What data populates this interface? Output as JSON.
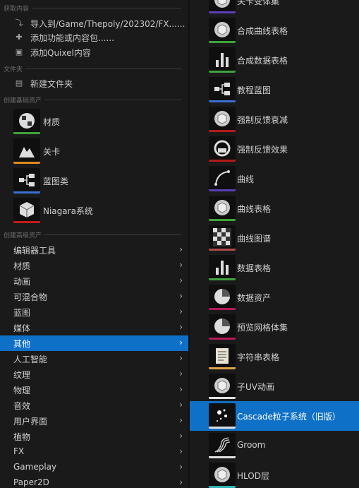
{
  "left": {
    "sections": {
      "get_content": "获取内容",
      "folder": "文件夹",
      "basic_assets": "创建基础资产",
      "advanced_assets": "创建高级资产"
    },
    "get_content_items": [
      {
        "label": "导入到/Game/Thepoly/202302/FX......",
        "icon": "import-icon"
      },
      {
        "label": "添加功能或内容包......",
        "icon": "add-feature-icon"
      },
      {
        "label": "添加Quixel内容",
        "icon": "quixel-icon"
      }
    ],
    "folder_items": [
      {
        "label": "新建文件夹",
        "icon": "new-folder-icon"
      }
    ],
    "basic_assets": [
      {
        "label": "材质",
        "icon": "material-icon",
        "color": "#3fa33a"
      },
      {
        "label": "关卡",
        "icon": "level-icon",
        "color": "#e08a1e"
      },
      {
        "label": "蓝图类",
        "icon": "blueprint-icon",
        "color": "#3c6fd6"
      },
      {
        "label": "Niagara系统",
        "icon": "niagara-icon",
        "color": "#c21b1b"
      }
    ],
    "advanced_menu": [
      "编辑器工具",
      "材质",
      "动画",
      "可混合物",
      "蓝图",
      "媒体",
      "其他",
      "人工智能",
      "纹理",
      "物理",
      "音效",
      "用户界面",
      "植物",
      "FX",
      "Gameplay",
      "Paper2D"
    ],
    "selected_menu": "其他",
    "chevron": "›"
  },
  "right": {
    "items": [
      {
        "label": "关卡变体集",
        "icon": "level-variant-icon",
        "color": "#5a3fb8"
      },
      {
        "label": "合成曲线表格",
        "icon": "composite-curve-table-icon",
        "color": "#3fa33a"
      },
      {
        "label": "合成数据表格",
        "icon": "composite-data-table-icon",
        "color": "#3fa33a"
      },
      {
        "label": "教程蓝图",
        "icon": "tutorial-blueprint-icon",
        "color": "#3c6fd6"
      },
      {
        "label": "强制反馈衰减",
        "icon": "force-feedback-attenuation-icon",
        "color": "#b51a1a"
      },
      {
        "label": "强制反馈效果",
        "icon": "force-feedback-effect-icon",
        "color": "#b51a1a"
      },
      {
        "label": "曲线",
        "icon": "curve-icon",
        "color": "#5a3fb8"
      },
      {
        "label": "曲线表格",
        "icon": "curve-table-icon",
        "color": "#3fa33a"
      },
      {
        "label": "曲线图谱",
        "icon": "curve-atlas-icon",
        "color": "#b04a4a"
      },
      {
        "label": "数据表格",
        "icon": "data-table-icon",
        "color": "#3fa33a"
      },
      {
        "label": "数据资产",
        "icon": "data-asset-icon",
        "color": "#b51a5a"
      },
      {
        "label": "预览网格体集",
        "icon": "preview-mesh-icon",
        "color": "#b51a5a"
      },
      {
        "label": "字符串表格",
        "icon": "string-table-icon",
        "color": "#e0a14a"
      },
      {
        "label": "子UV动画",
        "icon": "subuv-animation-icon",
        "color": "#e0e0e0"
      },
      {
        "label": "Cascade粒子系统（旧版）",
        "icon": "cascade-particle-icon",
        "color": "#e0e0e0"
      },
      {
        "label": "Groom",
        "icon": "groom-icon",
        "color": "#e0e0e0"
      },
      {
        "label": "HLOD层",
        "icon": "hlod-layer-icon",
        "color": "#2fb5b5"
      }
    ],
    "selected_item": "Cascade粒子系统（旧版）"
  }
}
